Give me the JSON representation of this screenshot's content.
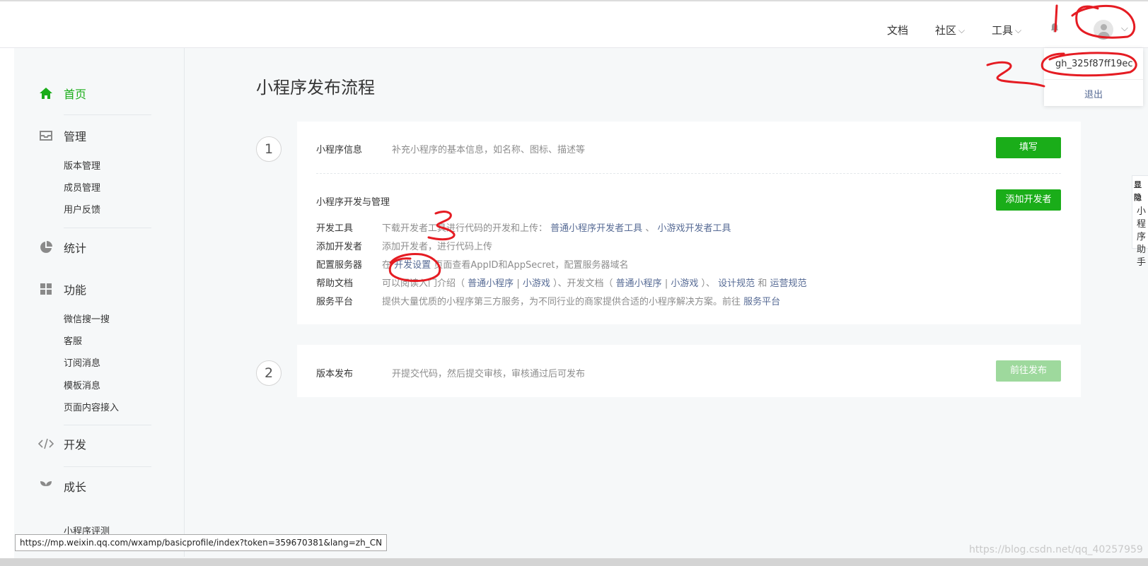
{
  "header": {
    "docs": "文档",
    "community": "社区",
    "tools": "工具",
    "account_id": "gh_325f87ff19ec",
    "logout": "退出"
  },
  "sidebar": {
    "home": "首页",
    "manage": "管理",
    "manage_items": [
      "版本管理",
      "成员管理",
      "用户反馈"
    ],
    "stats": "统计",
    "features": "功能",
    "feature_items": [
      "微信搜一搜",
      "客服",
      "订阅消息",
      "模板消息",
      "页面内容接入"
    ],
    "develop": "开发",
    "growth": "成长",
    "growth_items": [
      "小程序评测"
    ]
  },
  "main": {
    "title": "小程序发布流程",
    "step1": {
      "number": "1",
      "info_label": "小程序信息",
      "info_desc": "补充小程序的基本信息，如名称、图标、描述等",
      "info_button": "填写",
      "dev_title": "小程序开发与管理",
      "dev_button": "添加开发者",
      "rows": [
        {
          "label": "开发工具",
          "text": "下载开发者工具进行代码的开发和上传：",
          "link1": "普通小程序开发者工具",
          "sep": "、",
          "link2": "小游戏开发者工具"
        },
        {
          "label": "添加开发者",
          "text": "添加开发者，进行代码上传"
        },
        {
          "label": "配置服务器",
          "pre": "在",
          "link": "开发设置",
          "post": "页面查看AppID和AppSecret，配置服务器域名"
        },
        {
          "label": "帮助文档",
          "pre": "可以阅读入门介绍（",
          "l1": "普通小程序",
          "s1": "|",
          "l2": "小游戏",
          "mid": "）、开发文档（",
          "l3": "普通小程序",
          "s2": "|",
          "l4": "小游戏",
          "mid2": "）、",
          "l5": "设计规范",
          "and": "和",
          "l6": "运营规范"
        },
        {
          "label": "服务平台",
          "pre": "提供大量优质的小程序第三方服务，为不同行业的商家提供合适的小程序解决方案。前往",
          "link": "服务平台"
        }
      ]
    },
    "step2": {
      "number": "2",
      "label": "版本发布",
      "desc": "开提交代码，然后提交审核，审核通过后可发布",
      "button": "前往发布"
    }
  },
  "assistant": {
    "label_top": "显隐",
    "label": [
      "小",
      "程",
      "序",
      "助",
      "手"
    ]
  },
  "status_bar": {
    "url": "https://mp.weixin.qq.com/wxamp/basicprofile/index?token=359670381&lang=zh_CN"
  },
  "watermark": "https://blog.csdn.net/qq_40257959",
  "annotations": {
    "mark1": "1",
    "mark2": "2",
    "mark3": "3",
    "color": "#e51c23"
  },
  "colors": {
    "accent": "#1aad19",
    "link": "#576b95"
  }
}
